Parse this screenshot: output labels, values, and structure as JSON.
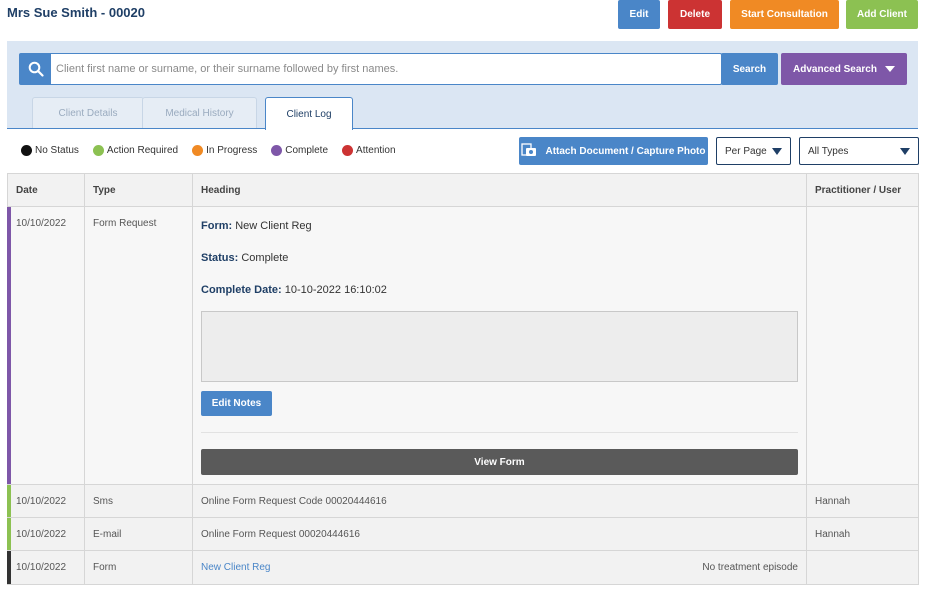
{
  "client": {
    "title": "Mrs Sue Smith - 00020"
  },
  "actions": {
    "edit": "Edit",
    "delete": "Delete",
    "start_consultation": "Start Consultation",
    "add_client": "Add Client"
  },
  "search": {
    "placeholder": "Client first name or surname, or their surname followed by first names.",
    "value": "",
    "button": "Search",
    "advanced": "Advanced Search"
  },
  "tabs": [
    {
      "label": "Client Details",
      "active": false
    },
    {
      "label": "Medical History",
      "active": false
    },
    {
      "label": "Client Log",
      "active": true
    }
  ],
  "legend": [
    {
      "label": "No Status",
      "color": "#111111"
    },
    {
      "label": "Action Required",
      "color": "#8cc152"
    },
    {
      "label": "In Progress",
      "color": "#f08a24"
    },
    {
      "label": "Complete",
      "color": "#7e57a8"
    },
    {
      "label": "Attention",
      "color": "#cc3333"
    }
  ],
  "toolbar": {
    "attach": "Attach Document / Capture Photo",
    "per_page": "Per Page",
    "all_types": "All Types"
  },
  "table": {
    "columns": [
      "Date",
      "Type",
      "Heading",
      "Practitioner / User"
    ],
    "rows": [
      {
        "date": "10/10/2022",
        "type": "Form Request",
        "status_color": "#7e57a8",
        "detail": {
          "form_label": "Form:",
          "form_value": "New Client Reg",
          "status_label": "Status:",
          "status_value": "Complete",
          "complete_label": "Complete Date:",
          "complete_value": "10-10-2022 16:10:02",
          "notes": "",
          "edit_notes": "Edit Notes",
          "view_form": "View Form"
        },
        "practitioner": ""
      },
      {
        "date": "10/10/2022",
        "type": "Sms",
        "status_color": "#8cc152",
        "heading": "Online Form Request Code 00020444616",
        "practitioner": "Hannah"
      },
      {
        "date": "10/10/2022",
        "type": "E-mail",
        "status_color": "#8cc152",
        "heading": "Online Form Request 00020444616",
        "practitioner": "Hannah"
      },
      {
        "date": "10/10/2022",
        "type": "Form",
        "status_color": "#333333",
        "heading": "New Client Reg",
        "heading_note": "No treatment episode",
        "practitioner": ""
      }
    ]
  }
}
